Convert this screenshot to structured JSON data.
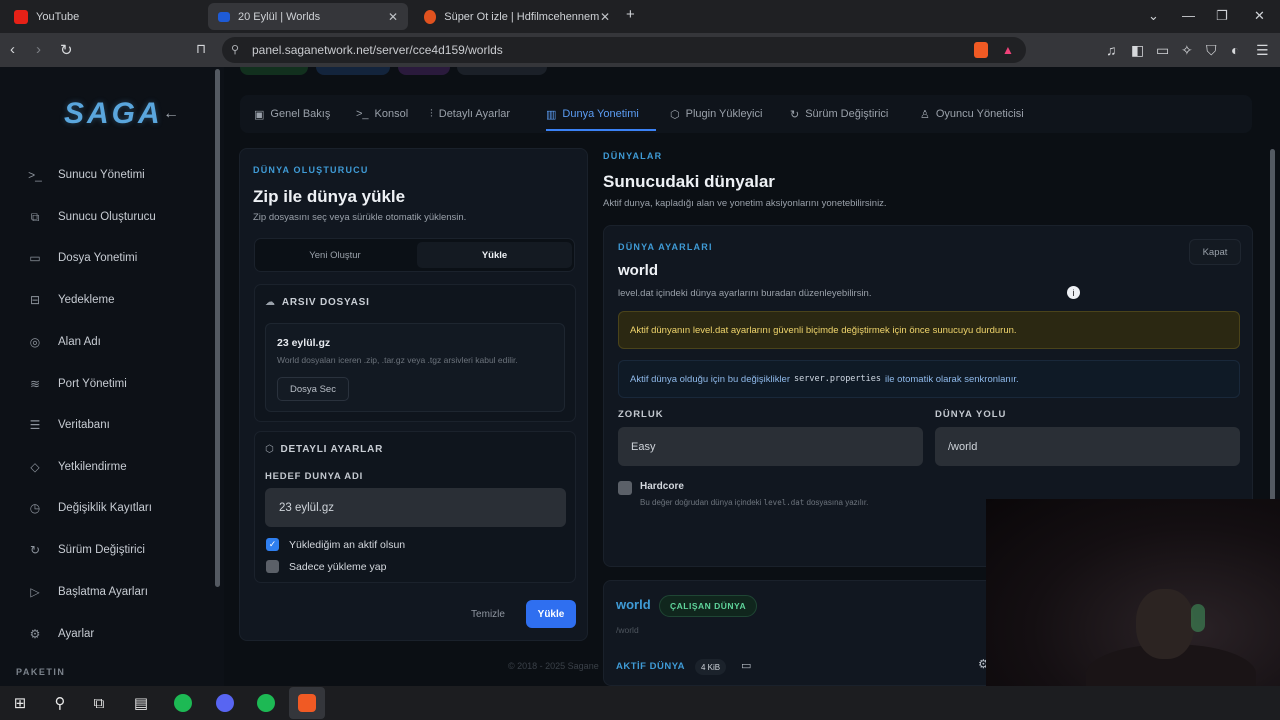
{
  "browser": {
    "tabs": [
      {
        "title": "YouTube",
        "icon": "youtube-icon"
      },
      {
        "title": "20 Eylül | Worlds",
        "icon": "saga-icon",
        "active": true
      },
      {
        "title": "Süper Ot izle | Hdfilmcehennemi | Fil",
        "icon": "film-icon"
      }
    ],
    "url": "panel.saganetwork.net/server/cce4d159/worlds"
  },
  "sidebar": {
    "logo": "SAGA",
    "items": [
      {
        "label": "Sunucu Yönetimi",
        "icon": ">_"
      },
      {
        "label": "Sunucu Oluşturucu",
        "icon": "⧉"
      },
      {
        "label": "Dosya Yonetimi",
        "icon": "▭"
      },
      {
        "label": "Yedekleme",
        "icon": "⊟"
      },
      {
        "label": "Alan Adı",
        "icon": "◎"
      },
      {
        "label": "Port Yönetimi",
        "icon": "≋"
      },
      {
        "label": "Veritabanı",
        "icon": "☰"
      },
      {
        "label": "Yetkilendirme",
        "icon": "◇"
      },
      {
        "label": "Değişiklik Kayıtları",
        "icon": "◷"
      },
      {
        "label": "Sürüm Değiştirici",
        "icon": "↻"
      },
      {
        "label": "Başlatma Ayarları",
        "icon": "▷"
      },
      {
        "label": "Ayarlar",
        "icon": "⚙"
      }
    ],
    "section": "PAKETIN"
  },
  "tabs": [
    {
      "label": "Genel Bakış",
      "icon": "▣"
    },
    {
      "label": "Konsol",
      "icon": ">_"
    },
    {
      "label": "Detaylı Ayarlar",
      "icon": "⫶"
    },
    {
      "label": "Dunya Yonetimi",
      "icon": "▥",
      "active": true
    },
    {
      "label": "Plugin Yükleyici",
      "icon": "⬡"
    },
    {
      "label": "Sürüm Değiştirici",
      "icon": "↻"
    },
    {
      "label": "Oyuncu Yöneticisi",
      "icon": "♙"
    }
  ],
  "creator": {
    "eyebrow": "DÜNYA OLUŞTURUCU",
    "title": "Zip ile dünya yükle",
    "subtitle": "Zip dosyasını seç veya sürükle otomatik yüklensin.",
    "seg_new": "Yeni Oluştur",
    "seg_upload": "Yükle",
    "archive_title": "ARSIV DOSYASI",
    "file_name": "23 eylül.gz",
    "file_hint": "World dosyaları iceren .zip, .tar.gz veya .tgz arsivleri kabul edilir.",
    "file_button": "Dosya Sec",
    "advanced_title": "DETAYLI AYARLAR",
    "target_label": "HEDEF DUNYA ADI",
    "target_value": "23 eylül.gz",
    "check_active": "Yüklediğim an aktif olsun",
    "check_only": "Sadece yükleme yap",
    "clear": "Temizle",
    "upload": "Yükle"
  },
  "worlds": {
    "eyebrow": "DÜNYALAR",
    "title": "Sunucudaki dünyalar",
    "subtitle": "Aktif dunya, kapladığı alan ve yonetim aksiyonlarını yonetebilirsiniz."
  },
  "settings": {
    "eyebrow": "DÜNYA AYARLARI",
    "close": "Kapat",
    "world": "world",
    "desc": "level.dat içindeki dünya ayarlarını buradan düzenleyebilirsin.",
    "warning": "Aktif dünyanın level.dat ayarlarını güvenli biçimde değiştirmek için önce sunucuyu durdurun.",
    "info_pre": "Aktif dünya olduğu için bu değişiklikler",
    "info_code": "server.properties",
    "info_post": "ile otomatik olarak senkronlanır.",
    "difficulty_label": "ZORLUK",
    "difficulty_value": "Easy",
    "path_label": "DÜNYA YOLU",
    "path_value": "/world",
    "hardcore_label": "Hardcore",
    "hint_pre": "Bu değer doğrudan dünya içindeki",
    "hint_code": "level.dat",
    "hint_post": "dosyasına yazılır."
  },
  "world_card": {
    "name": "world",
    "badge": "ÇALIŞAN DÜNYA",
    "path": "/world",
    "active_label": "AKTİF DÜNYA",
    "size": "4 KiB"
  },
  "footer": "© 2018 - 2025 Sagane",
  "colors": {
    "accent": "#3b82f6",
    "eyebrow": "#3f9bd6",
    "warning": "#f0d56c",
    "success": "#5fd49b"
  }
}
